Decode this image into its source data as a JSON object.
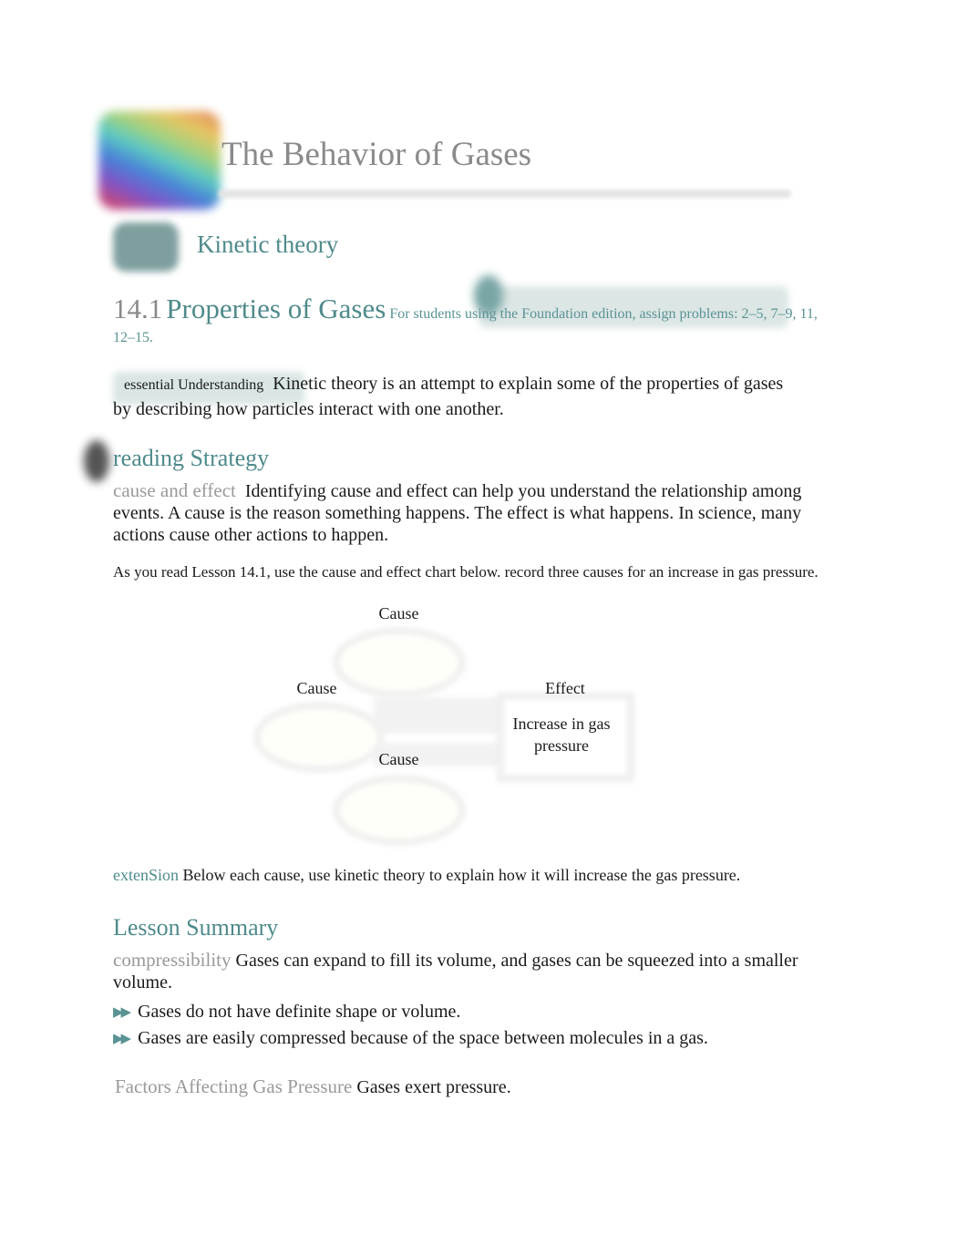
{
  "header": {
    "chapter_icon": "rainbow-chapter-icon",
    "title": "The Behavior of Gases"
  },
  "section": {
    "badge_icon": "section-badge-icon",
    "title": "Kinetic theory"
  },
  "lesson": {
    "number": "14.1",
    "name": "Properties of Gases",
    "assignment_note": "For students using the Foundation edition, assign problems: 2–5, 7–9, 11, 12–15."
  },
  "essential_understanding": {
    "label": "essential Understanding",
    "text": "Kinetic theory is an attempt to explain some of the properties of gases by describing how particles interact with one another."
  },
  "reading_strategy": {
    "title": "reading Strategy",
    "term": "cause and effect",
    "text": "Identifying cause and effect can help you understand the relationship among events. A cause is the reason something happens. The effect is what happens. In science, many actions cause other actions to happen.",
    "instruction": "As you read Lesson 14.1, use the cause and effect chart below. record three causes for an increase in gas pressure."
  },
  "diagram": {
    "cause_top": "Cause",
    "cause_left": "Cause",
    "cause_bottom": "Cause",
    "effect_label": "Effect",
    "effect_text": "Increase in gas pressure"
  },
  "extension": {
    "label": "extenSion",
    "text": "Below each cause, use kinetic theory to explain how it will increase the gas pressure."
  },
  "lesson_summary": {
    "title": "Lesson Summary",
    "compressibility_term": "compressibility",
    "compressibility_text": "Gases can expand to fill its volume, and gases can be squeezed into a smaller volume.",
    "bullets": [
      "Gases do not have definite shape or volume.",
      "Gases are easily compressed because of the space between molecules in a gas."
    ],
    "bullet_icon": "double-arrow-icon",
    "factors_term": "Factors Affecting Gas Pressure",
    "factors_text": "Gases exert pressure."
  }
}
